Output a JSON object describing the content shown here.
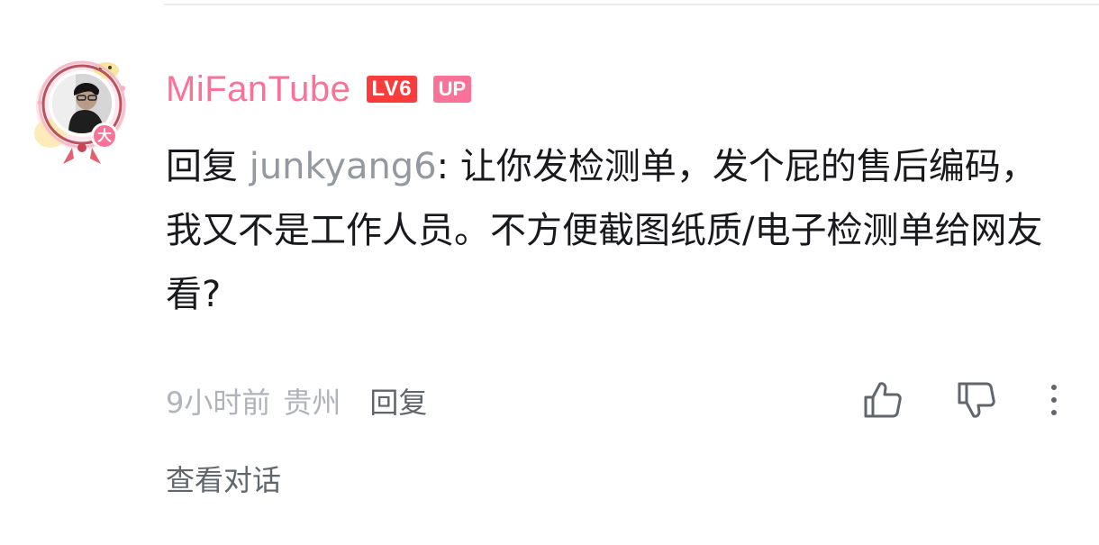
{
  "comment": {
    "username": "MiFanTube",
    "level_badge": "LV6",
    "up_badge": "UP",
    "vip_badge": "大",
    "reply_prefix": "回复 ",
    "mention": "junkyang6",
    "text": ": 让你发检测单，发个屁的售后编码，我又不是工作人员。不方便截图纸质/电子检测单给网友看?",
    "time": "9小时前",
    "location": "贵州",
    "reply_label": "回复",
    "view_conversation": "查看对话"
  },
  "icons": {
    "like": "thumbs-up-icon",
    "dislike": "thumbs-down-icon",
    "more": "more-vertical-icon"
  },
  "colors": {
    "username": "#fb7299",
    "level_badge": "#fb3c3c",
    "up_badge": "#fb7299",
    "mention": "#9499a0",
    "meta": "#b0b4ba"
  }
}
